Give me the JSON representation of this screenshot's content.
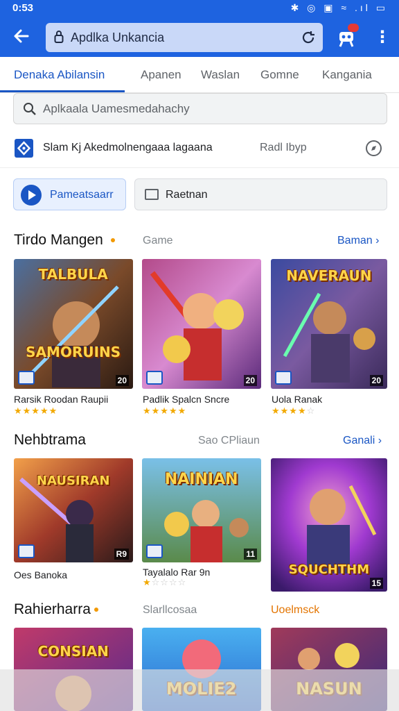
{
  "status": {
    "time": "0:53",
    "icons": "✱ ◎ ▣ ≈ .ıl ▭"
  },
  "urlbar": {
    "text": "Apdlka Unkancia"
  },
  "colors": {
    "brand": "#1e63e0",
    "accent": "#1a56c4",
    "star": "#f2a900"
  },
  "tabs": [
    {
      "label": "Denaka Abilansin"
    },
    {
      "label": "Apanen"
    },
    {
      "label": "Waslan"
    },
    {
      "label": "Gomne"
    },
    {
      "label": "Kangania"
    }
  ],
  "search": {
    "placeholder": "Aplkaala Uamesmedahachy"
  },
  "inforow": {
    "text": "Slam Kj Akedmolnengaaa lagaana",
    "right": "Radl Ibyp"
  },
  "chips": {
    "primary": "Pameatsaarr",
    "secondary": "Raetnan"
  },
  "sections": [
    {
      "title": "Tirdo Mangen",
      "mid": "Game",
      "more": "Baman ›",
      "cards": [
        {
          "art_text": "TALBULA\nSAMORUINS",
          "badge": "20",
          "name": "Rarsik Roodan Raupii",
          "rating": 4.5
        },
        {
          "art_text": "",
          "badge": "20",
          "name": "Padlik Spalcn Sncre",
          "rating": 5
        },
        {
          "art_text": "NAVERAUN",
          "badge": "20",
          "name": "Uola Ranak",
          "rating": 4
        }
      ]
    },
    {
      "title": "Nehbtrama",
      "mid": "Sao CPliaun",
      "more": "Ganali ›",
      "cards": [
        {
          "art_text": "NAUSIRAN",
          "badge": "R9",
          "name": "Oes Banoka",
          "rating": null
        },
        {
          "art_text": "NAINIAN",
          "badge": "11",
          "name": "Tayalalo Rar 9n",
          "rating": 1
        },
        {
          "art_text": "SQUCHTHM",
          "badge": "15",
          "name": "",
          "rating": null
        }
      ]
    },
    {
      "title": "Rahierharra",
      "mid": "Slarllcosaa",
      "more": "Uoelmsck",
      "cards": [
        {
          "art_text": "CONSIAN"
        },
        {
          "art_text": "MOLIE2"
        },
        {
          "art_text": "NASUN"
        }
      ]
    }
  ]
}
